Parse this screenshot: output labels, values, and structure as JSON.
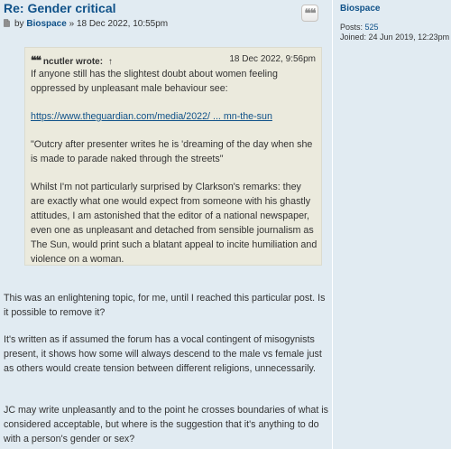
{
  "post": {
    "title": "Re: Gender critical",
    "by_label": "by",
    "author": "Biospace",
    "separator": "»",
    "date": "18 Dec 2022, 10:55pm",
    "quote_button_glyph": "❝❝"
  },
  "quote": {
    "author": "ncutler",
    "wrote": "wrote:",
    "arrow": "↑",
    "date": "18 Dec 2022, 9:56pm",
    "paragraphs": [
      "If anyone still has the slightest doubt about women feeling oppressed by unpleasant male behaviour see:",
      "\"Outcry after presenter writes he is 'dreaming of the day when she is made to parade naked through the streets\"",
      "Whilst I'm not particularly surprised by Clarkson's remarks: they are exactly what one would expect from someone with his ghastly attitudes, I am astonished that the editor of a national newspaper, even one as unpleasant and detached from sensible journalism as The Sun, would print such a blatant appeal to incite humiliation and violence on a woman."
    ],
    "link": "https://www.theguardian.com/media/2022/ ... mn-the-sun"
  },
  "body": {
    "paragraphs": [
      "This was an enlightening topic, for me, until I reached this particular post. Is it possible to remove it?",
      "It's written as if assumed the forum has a vocal contingent of misogynists present, it shows how some will always descend to the male vs female just as others would create tension between different religions, unnecessarily.",
      "JC may write unpleasantly and to the point he crosses boundaries of what is considered acceptable, but where is the suggestion that it's anything to do with a person's gender or sex?"
    ]
  },
  "profile": {
    "username": "Biospace",
    "posts_label": "Posts:",
    "posts_value": "525",
    "joined_label": "Joined:",
    "joined_value": "24 Jun 2019, 12:23pm"
  },
  "colors": {
    "background": "#e1ebf2",
    "link": "#105289",
    "quote_bg": "#ebeadd",
    "text": "#333333"
  },
  "icons": [
    "post-document-icon",
    "quote-icon"
  ]
}
